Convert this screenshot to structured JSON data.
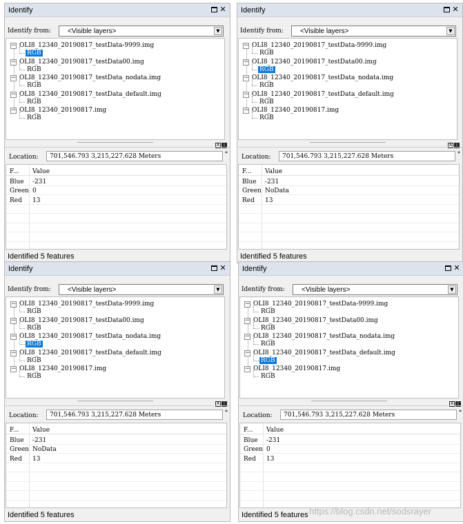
{
  "panels": [
    {
      "title": "Identify",
      "identify_from_label": "Identify from:",
      "identify_from_value": "<Visible layers>",
      "tree": [
        {
          "label": "OLI8_12340_20190817_testData-9999.img",
          "child": "RGB",
          "selected": true
        },
        {
          "label": "OLI8_12340_20190817_testData00.img",
          "child": "RGB",
          "selected": false
        },
        {
          "label": "OLI8_12340_20190817_testData_nodata.img",
          "child": "RGB",
          "selected": false
        },
        {
          "label": "OLI8_12340_20190817_testData_default.img",
          "child": "RGB",
          "selected": false
        },
        {
          "label": "OLI8_12340_20190817.img",
          "child": "RGB",
          "selected": false
        }
      ],
      "location_label": "Location:",
      "location_value": "701,546.793  3,215,227.628 Meters",
      "columns": [
        "F...",
        "Value"
      ],
      "rows": [
        [
          "Blue",
          "-231"
        ],
        [
          "Green",
          "0"
        ],
        [
          "Red",
          "13"
        ]
      ],
      "status": "Identified 5 features"
    },
    {
      "title": "Identify",
      "identify_from_label": "Identify from:",
      "identify_from_value": "<Visible layers>",
      "tree": [
        {
          "label": "OLI8_12340_20190817_testData-9999.img",
          "child": "RGB",
          "selected": false
        },
        {
          "label": "OLI8_12340_20190817_testData00.img",
          "child": "RGB",
          "selected": true
        },
        {
          "label": "OLI8_12340_20190817_testData_nodata.img",
          "child": "RGB",
          "selected": false
        },
        {
          "label": "OLI8_12340_20190817_testData_default.img",
          "child": "RGB",
          "selected": false
        },
        {
          "label": "OLI8_12340_20190817.img",
          "child": "RGB",
          "selected": false
        }
      ],
      "location_label": "Location:",
      "location_value": "701,546.793  3,215,227.628 Meters",
      "columns": [
        "F...",
        "Value"
      ],
      "rows": [
        [
          "Blue",
          "-231"
        ],
        [
          "Green",
          "NoData"
        ],
        [
          "Red",
          "13"
        ]
      ],
      "status": "Identified 5 features"
    },
    {
      "title": "Identify",
      "identify_from_label": "Identify from:",
      "identify_from_value": "<Visible layers>",
      "tree": [
        {
          "label": "OLI8_12340_20190817_testData-9999.img",
          "child": "RGB",
          "selected": false
        },
        {
          "label": "OLI8_12340_20190817_testData00.img",
          "child": "RGB",
          "selected": false
        },
        {
          "label": "OLI8_12340_20190817_testData_nodata.img",
          "child": "RGB",
          "selected": true
        },
        {
          "label": "OLI8_12340_20190817_testData_default.img",
          "child": "RGB",
          "selected": false
        },
        {
          "label": "OLI8_12340_20190817.img",
          "child": "RGB",
          "selected": false
        }
      ],
      "location_label": "Location:",
      "location_value": "701,546.793  3,215,227.628 Meters",
      "columns": [
        "F...",
        "Value"
      ],
      "rows": [
        [
          "Blue",
          "-231"
        ],
        [
          "Green",
          "NoData"
        ],
        [
          "Red",
          "13"
        ]
      ],
      "status": "Identified 5 features"
    },
    {
      "title": "Identify",
      "identify_from_label": "Identify from:",
      "identify_from_value": "<Visible layers>",
      "tree": [
        {
          "label": "OLI8_12340_20190817_testData-9999.img",
          "child": "RGB",
          "selected": false
        },
        {
          "label": "OLI8_12340_20190817_testData00.img",
          "child": "RGB",
          "selected": false
        },
        {
          "label": "OLI8_12340_20190817_testData_nodata.img",
          "child": "RGB",
          "selected": false
        },
        {
          "label": "OLI8_12340_20190817_testData_default.img",
          "child": "RGB",
          "selected": true
        },
        {
          "label": "OLI8_12340_20190817.img",
          "child": "RGB",
          "selected": false
        }
      ],
      "location_label": "Location:",
      "location_value": "701,546.793  3,215,227.628 Meters",
      "columns": [
        "F...",
        "Value"
      ],
      "rows": [
        [
          "Blue",
          "-231"
        ],
        [
          "Green",
          "0"
        ],
        [
          "Red",
          "13"
        ]
      ],
      "status": "Identified 5 features"
    }
  ],
  "watermark": "https://blog.csdn.net/sodsrayer",
  "colors": {
    "selection": "#0a78d7",
    "titlebar": "#dde3ec",
    "panel_bg": "#f0f0f0"
  },
  "icons": {
    "restore": "restore-icon",
    "close": "close-icon",
    "expander": "minus-expander-icon",
    "dropdown": "chevron-down-icon"
  }
}
